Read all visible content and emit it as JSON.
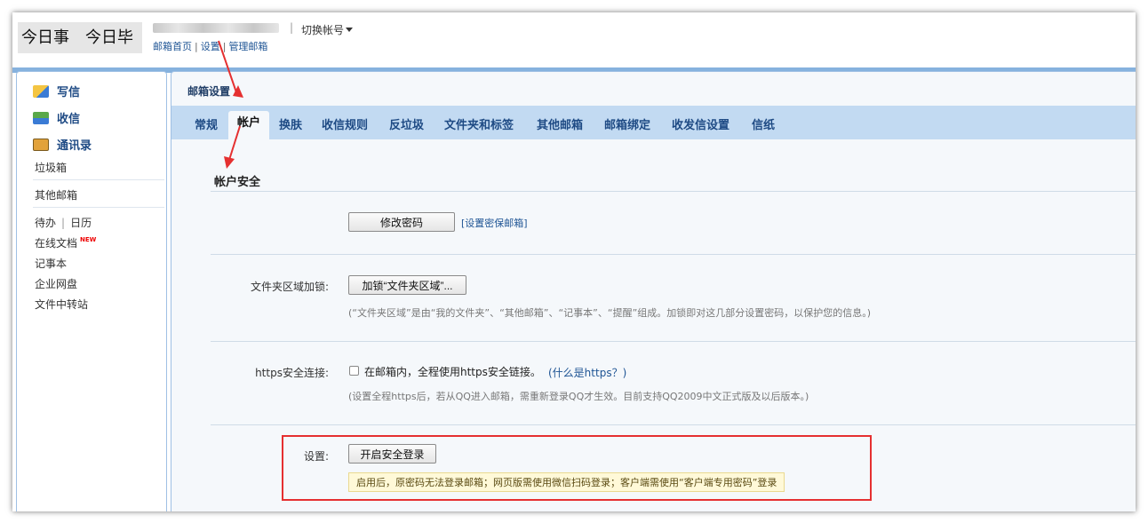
{
  "header": {
    "logo_text": "今日事　今日毕",
    "switch_account": "切换帐号",
    "links": [
      "邮箱首页",
      "设置",
      "管理邮箱"
    ]
  },
  "sidebar": {
    "compose": "写信",
    "inbox": "收信",
    "contacts": "通讯录",
    "trash": "垃圾箱",
    "other_mailbox": "其他邮箱",
    "todo": "待办",
    "calendar": "日历",
    "online_docs": "在线文档",
    "new_badge": "NEW",
    "notebook": "记事本",
    "netdisk": "企业网盘",
    "file_transfer": "文件中转站"
  },
  "main": {
    "title": "邮箱设置",
    "tabs": [
      {
        "label": "常规",
        "active": false
      },
      {
        "label": "帐户",
        "active": true
      },
      {
        "label": "换肤",
        "active": false
      },
      {
        "label": "收信规则",
        "active": false
      },
      {
        "label": "反垃圾",
        "active": false
      },
      {
        "label": "文件夹和标签",
        "active": false
      },
      {
        "label": "其他邮箱",
        "active": false
      },
      {
        "label": "邮箱绑定",
        "active": false
      },
      {
        "label": "收发信设置",
        "active": false
      },
      {
        "label": "信纸",
        "active": false
      }
    ],
    "section_title": "帐户安全",
    "change_password_button": "修改密码",
    "set_recovery_link": "[设置密保邮箱]",
    "folder_lock_label": "文件夹区域加锁:",
    "folder_lock_button": "加锁“文件夹区域”...",
    "folder_lock_hint": "(“文件夹区域”是由“我的文件夹”、“其他邮箱”、“记事本”、“提醒”组成。加锁即对这几部分设置密码，以保护您的信息。)",
    "https_label": "https安全连接:",
    "https_checkbox_text": "在邮箱内，全程使用https安全链接。",
    "https_help_link": "(什么是https？)",
    "https_hint": "(设置全程https后，若从QQ进入邮箱，需重新登录QQ才生效。目前支持QQ2009中文正式版及以后版本。)",
    "security_label": "设置:",
    "secure_login_button": "开启安全登录",
    "secure_login_notice": "启用后，原密码无法登录邮箱；网页版需使用微信扫码登录；客户端需使用“客户端专用密码”登录"
  },
  "colors": {
    "annotation_red": "#e53030",
    "tab_bar": "#c2daf2",
    "link_blue": "#1e5494"
  }
}
